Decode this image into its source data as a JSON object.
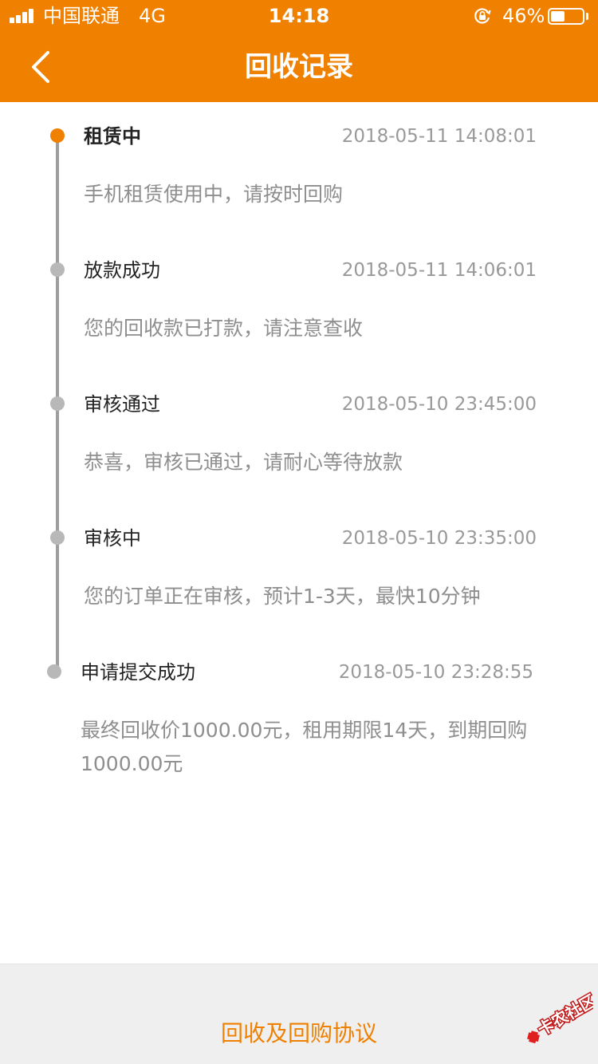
{
  "status_bar": {
    "carrier": "中国联通",
    "network": "4G",
    "time": "14:18",
    "battery_percent": "46%",
    "battery_level": 0.46,
    "signal_bars": 4,
    "icons": [
      "signal-icon",
      "orientation-lock-icon",
      "battery-icon"
    ]
  },
  "header": {
    "title": "回收记录",
    "back_icon": "chevron-left-icon"
  },
  "timeline": [
    {
      "status": "租赁中",
      "time": "2018-05-11 14:08:01",
      "desc": "手机租赁使用中，请按时回购",
      "active": true
    },
    {
      "status": "放款成功",
      "time": "2018-05-11 14:06:01",
      "desc": "您的回收款已打款，请注意查收",
      "active": false
    },
    {
      "status": "审核通过",
      "time": "2018-05-10 23:45:00",
      "desc": "恭喜，审核已通过，请耐心等待放款",
      "active": false
    },
    {
      "status": "审核中",
      "time": "2018-05-10 23:35:00",
      "desc": "您的订单正在审核，预计1-3天，最快10分钟",
      "active": false
    },
    {
      "status": "申请提交成功",
      "time": "2018-05-10 23:28:55",
      "desc_line1": "最终回收价1000.00元，租用期限14天，到期回购",
      "desc_line2": "1000.00元",
      "active": false
    }
  ],
  "footer": {
    "agreement_label": "回收及回购协议"
  },
  "watermark": {
    "text": "卡农社区"
  },
  "colors": {
    "accent": "#f08000",
    "timeline_gray": "#9e9e9e",
    "dot_gray": "#b8b8b8",
    "desc_gray": "#8e8e8e",
    "time_gray": "#999999",
    "footer_bg": "#efefef"
  }
}
